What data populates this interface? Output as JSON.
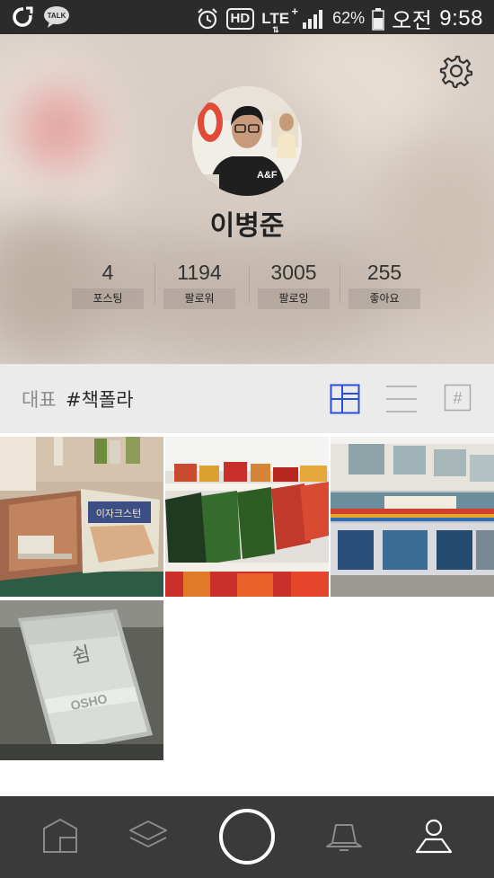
{
  "status_bar": {
    "battery": "62%",
    "ampm": "오전",
    "time": "9:58",
    "network_lte": "LTE",
    "hd_badge": "HD",
    "talk_label": "TALK"
  },
  "profile": {
    "name": "이병준",
    "shirt_text": "A&F",
    "stats": [
      {
        "value": "4",
        "label": "포스팅"
      },
      {
        "value": "1194",
        "label": "팔로워"
      },
      {
        "value": "3005",
        "label": "팔로잉"
      },
      {
        "value": "255",
        "label": "좋아요"
      }
    ]
  },
  "album": {
    "label": "대표",
    "name": "#책폴라",
    "active_view": "grid"
  },
  "photos": [
    {
      "subject": "book-on-desk",
      "book_title": "이자크스턴"
    },
    {
      "subject": "store-shelf-snacks"
    },
    {
      "subject": "convenience-store-front"
    },
    {
      "subject": "book-osho",
      "book_title": "쉼",
      "book_author": "OSHO"
    }
  ],
  "nav": {
    "items": [
      "home-icon",
      "layers-icon",
      "camera-button",
      "bell-icon",
      "profile-icon"
    ]
  },
  "colors": {
    "accent": "#2a4fd6",
    "status_bar": "#2b2b2b",
    "bottom_nav": "#3a3a3a",
    "tab_bar": "#ebebeb"
  }
}
